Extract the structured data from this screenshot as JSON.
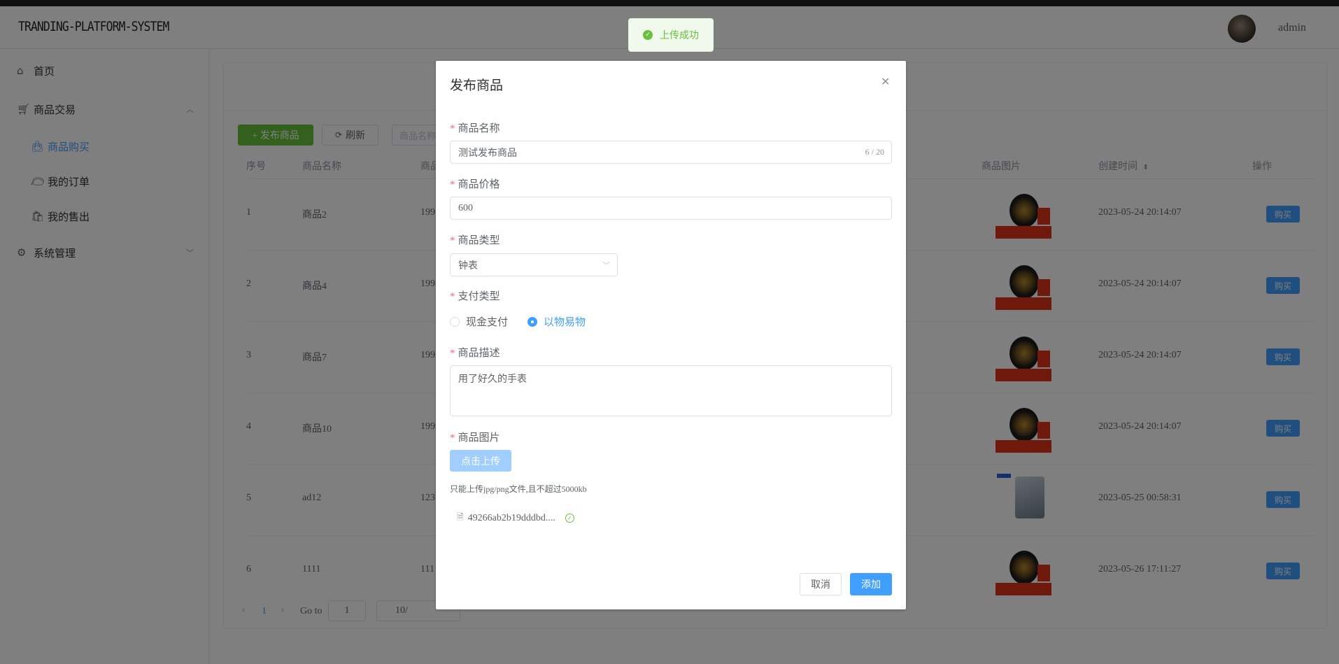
{
  "header": {
    "logo": "TRANDING-PLATFORM-SYSTEM",
    "username": "admin"
  },
  "sidebar": {
    "home": "首页",
    "trade": "商品交易",
    "buy": "商品购买",
    "orders": "我的订单",
    "sales": "我的售出",
    "system": "系统管理"
  },
  "toolbar": {
    "publish": "+ 发布商品",
    "refresh": "刷新",
    "search_placeholder": "商品名称"
  },
  "table": {
    "headers": {
      "no": "序号",
      "name": "商品名称",
      "price": "商品",
      "image": "商品图片",
      "created": "创建时间",
      "action": "操作"
    },
    "sort_icon": "sort-icon",
    "rows": [
      {
        "no": "1",
        "name": "商品2",
        "price": "199",
        "created": "2023-05-24 20:14:07",
        "action": "购买",
        "image": "watch"
      },
      {
        "no": "2",
        "name": "商品4",
        "price": "199",
        "created": "2023-05-24 20:14:07",
        "action": "购买",
        "image": "watch"
      },
      {
        "no": "3",
        "name": "商品7",
        "price": "199",
        "created": "2023-05-24 20:14:07",
        "action": "购买",
        "image": "watch"
      },
      {
        "no": "4",
        "name": "商品10",
        "price": "199",
        "created": "2023-05-24 20:14:07",
        "action": "购买",
        "image": "watch"
      },
      {
        "no": "5",
        "name": "ad12",
        "price": "123",
        "created": "2023-05-25 00:58:31",
        "action": "购买",
        "image": "phone"
      },
      {
        "no": "6",
        "name": "1111",
        "price": "111",
        "created": "2023-05-26 17:11:27",
        "action": "购买",
        "image": "watch"
      }
    ]
  },
  "pager": {
    "current": "1",
    "goto_label": "Go to",
    "goto_value": "1",
    "size": "10/"
  },
  "dialog": {
    "title": "发布商品",
    "name_label": "商品名称",
    "name_value": "测试发布商品",
    "name_count": "6 / 20",
    "price_label": "商品价格",
    "price_value": "600",
    "type_label": "商品类型",
    "type_value": "钟表",
    "pay_label": "支付类型",
    "pay_options": [
      "现金支付",
      "以物易物"
    ],
    "pay_selected": "以物易物",
    "desc_label": "商品描述",
    "desc_value": "用了好久的手表",
    "image_label": "商品图片",
    "upload_button": "点击上传",
    "upload_tip": "只能上传jpg/png文件,且不超过5000kb",
    "file_name": "49266ab2b19dddbd....",
    "cancel": "取消",
    "confirm": "添加"
  },
  "toast": {
    "message": "上传成功"
  },
  "colors": {
    "primary": "#409eff",
    "success": "#67c23a",
    "danger": "#f56c6c"
  }
}
